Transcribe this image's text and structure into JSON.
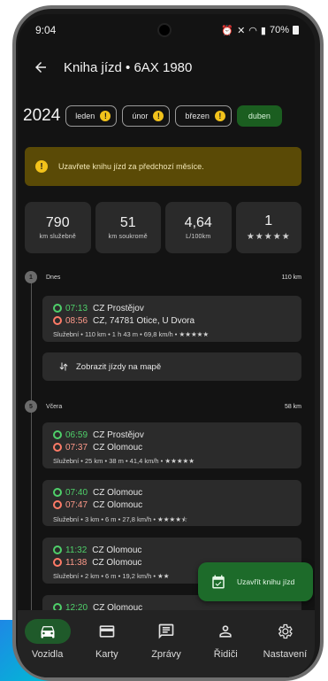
{
  "status": {
    "time": "9:04",
    "battery": "70%"
  },
  "header": {
    "title": "Kniha jízd • 6AX 1980"
  },
  "months": {
    "year": "2024",
    "chips": [
      {
        "label": "leden",
        "warning": "!"
      },
      {
        "label": "únor",
        "warning": "!"
      },
      {
        "label": "březen",
        "warning": "!"
      }
    ],
    "active": "duben"
  },
  "banner": {
    "icon": "!",
    "text": "Uzavřete knihu jízd za předchozí měsíce."
  },
  "stats": [
    {
      "value": "790",
      "label": "km služebně"
    },
    {
      "value": "51",
      "label": "km soukromě"
    },
    {
      "value": "4,64",
      "label": "L/100km"
    },
    {
      "value": "1",
      "label": "★★★★★"
    }
  ],
  "days": [
    {
      "count": "1",
      "name": "Dnes",
      "km": "110 km",
      "trips": [
        {
          "start_time": "07:13",
          "start_place": "CZ Prostějov",
          "end_time": "08:56",
          "end_place": "CZ, 74781 Otice, U Dvora",
          "info": "Služební • 110 km • 1 h 43 m • 69,8 km/h • ★★★★★"
        }
      ]
    },
    {
      "count": "5",
      "name": "Včera",
      "km": "58 km",
      "trips": [
        {
          "start_time": "06:59",
          "start_place": "CZ Prostějov",
          "end_time": "07:37",
          "end_place": "CZ Olomouc",
          "info": "Služební • 25 km • 38 m • 41,4 km/h • ★★★★★"
        },
        {
          "start_time": "07:40",
          "start_place": "CZ Olomouc",
          "end_time": "07:47",
          "end_place": "CZ Olomouc",
          "info": "Služební • 3 km • 6 m • 27,8 km/h • ★★★★⯪"
        },
        {
          "start_time": "11:32",
          "start_place": "CZ Olomouc",
          "end_time": "11:38",
          "end_place": "CZ Olomouc",
          "info": "Služební • 2 km • 6 m • 19,2 km/h • ★★"
        },
        {
          "start_time": "12:20",
          "start_place": "CZ Olomouc"
        }
      ]
    }
  ],
  "map_button": {
    "label": "Zobrazit jízdy na mapě"
  },
  "fab": {
    "label": "Uzavřít knihu jízd"
  },
  "nav": [
    {
      "label": "Vozidla",
      "icon": "car-icon"
    },
    {
      "label": "Karty",
      "icon": "card-icon"
    },
    {
      "label": "Zprávy",
      "icon": "message-icon"
    },
    {
      "label": "Řidiči",
      "icon": "person-icon"
    },
    {
      "label": "Nastavení",
      "icon": "settings-icon"
    }
  ],
  "colors": {
    "active_green": "#1b5e20",
    "warning": "#f2c21b",
    "banner": "#5a4a06",
    "start": "#4fd06a",
    "end": "#ff7b67"
  }
}
